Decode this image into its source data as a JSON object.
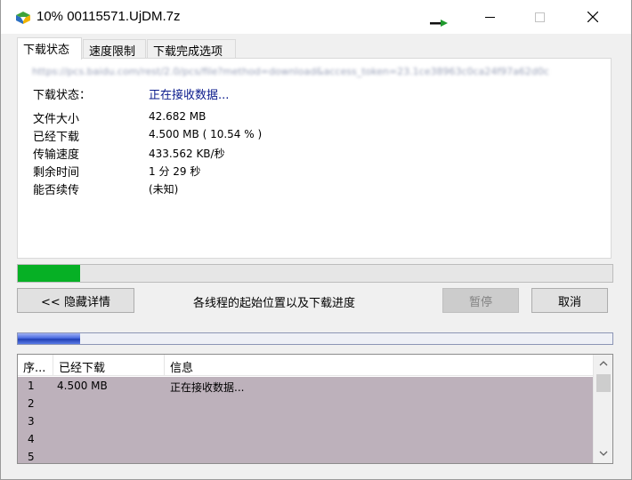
{
  "window": {
    "title": "10% 00115571.UjDM.7z"
  },
  "tabs": [
    {
      "label": "下载状态",
      "active": true
    },
    {
      "label": "速度限制",
      "active": false
    },
    {
      "label": "下载完成选项",
      "active": false
    }
  ],
  "download": {
    "url": "https://pcs.baidu.com/rest/2.0/pcs/file?method=download&access_token=23.1ce38963c0ca24f97a62d0c",
    "status_label": "下载状态：",
    "status_value": "正在接收数据...",
    "fields": [
      {
        "label": "文件大小",
        "value": "42.682  MB"
      },
      {
        "label": "已经下载",
        "value": "4.500  MB  ( 10.54 % )"
      },
      {
        "label": "传输速度",
        "value": "433.562  KB/秒"
      },
      {
        "label": "剩余时间",
        "value": "1 分 29 秒"
      },
      {
        "label": "能否续传",
        "value": "(未知)"
      }
    ],
    "progress_fraction": 0.1054
  },
  "controls": {
    "details_button": "<< 隐藏详情",
    "threads_caption": "各线程的起始位置以及下载进度",
    "pause_button": "暂停",
    "cancel_button": "取消"
  },
  "thread_progress_fraction": 0.1054,
  "threads_table": {
    "columns": [
      "序...",
      "已经下载",
      "信息"
    ],
    "rows": [
      {
        "index": "1",
        "downloaded": "4.500  MB",
        "info": "正在接收数据..."
      },
      {
        "index": "2",
        "downloaded": "",
        "info": ""
      },
      {
        "index": "3",
        "downloaded": "",
        "info": ""
      },
      {
        "index": "4",
        "downloaded": "",
        "info": ""
      },
      {
        "index": "5",
        "downloaded": "",
        "info": ""
      }
    ]
  },
  "colors": {
    "progress_green": "#06b025",
    "status_text": "#0a1a8c",
    "thread_bar": "#213fb4",
    "row_selected": "#bdb1bb"
  },
  "icons": [
    "idm-app-icon",
    "minimize-icon",
    "maximize-icon",
    "close-icon",
    "scroll-up-icon",
    "scroll-down-icon"
  ]
}
